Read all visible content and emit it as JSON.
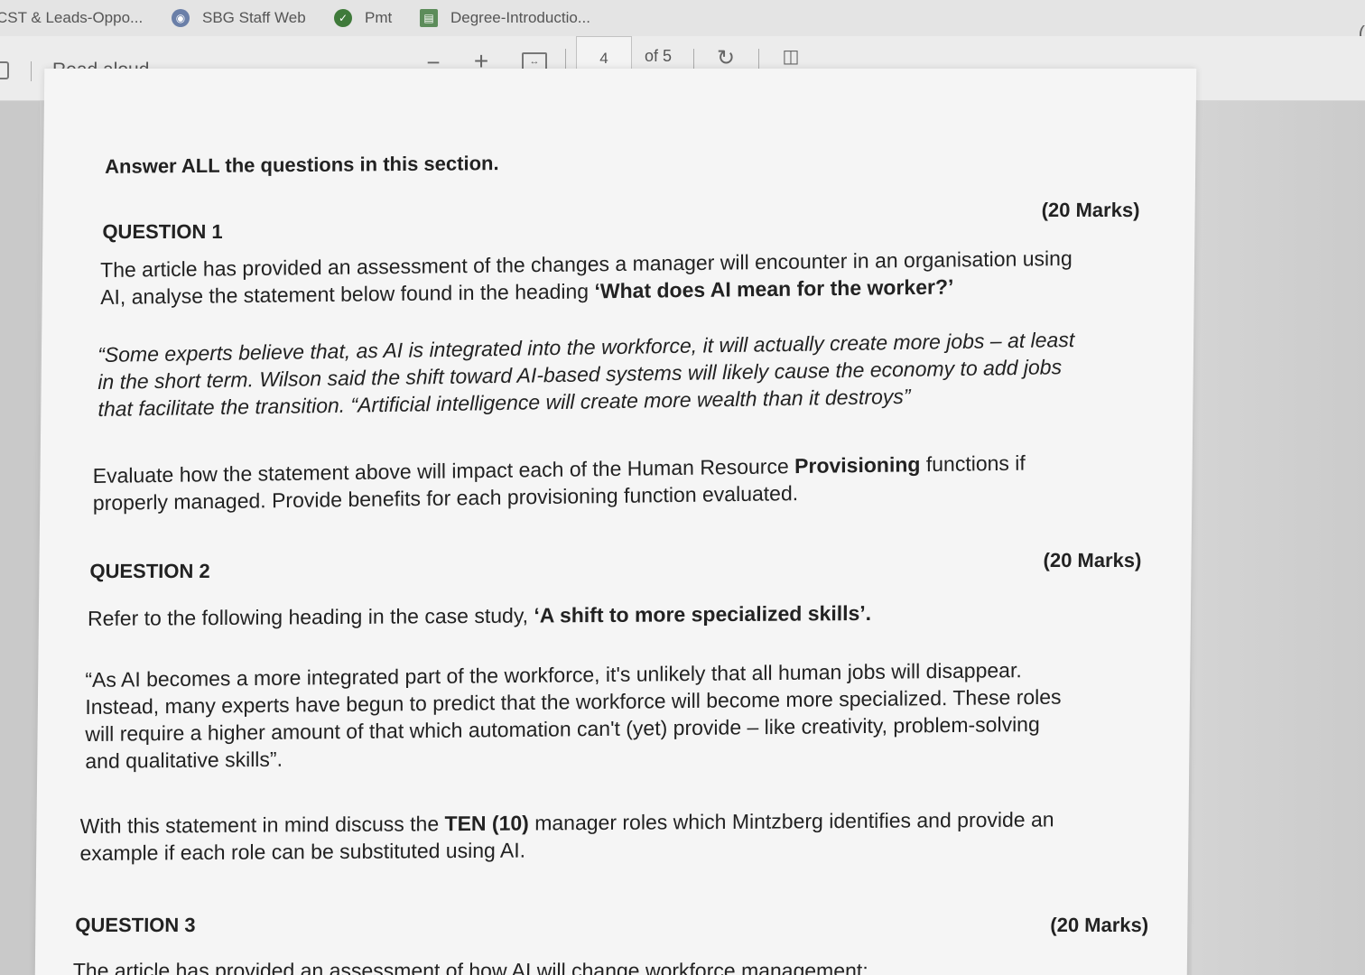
{
  "bookmarks": [
    {
      "label": "CST & Leads-Oppo...",
      "icon": "page-icon"
    },
    {
      "label": "SBG Staff Web",
      "icon": "globe-icon"
    },
    {
      "label": "Pmt",
      "icon": "check-icon"
    },
    {
      "label": "Degree-Introductio...",
      "icon": "book-icon"
    }
  ],
  "toolbar": {
    "read_aloud": "Read aloud",
    "zoom_out": "−",
    "zoom_in": "+",
    "page_current": "4",
    "page_total": "of 5"
  },
  "document": {
    "intro": "Answer ALL the questions in this section.",
    "q1": {
      "title": "QUESTION 1",
      "marks": "(20 Marks)",
      "p1_line1": "The article has provided an assessment of the changes a manager will encounter in an organisation using",
      "p1_line2_a": "AI, analyse the statement below found in the heading ",
      "p1_line2_b": "‘What does AI mean for the worker?’",
      "quote_line1": "“Some experts believe that, as AI is integrated into the workforce, it will actually create more jobs – at least",
      "quote_line2": "in the short term. Wilson said the shift toward AI-based systems will likely cause the economy to add jobs",
      "quote_line3": "that facilitate the transition. “Artificial intelligence will create more wealth than it destroys”",
      "task_line1_a": "Evaluate how the statement above will impact each of the Human Resource ",
      "task_line1_b": "Provisioning",
      "task_line1_c": " functions if",
      "task_line2": "properly managed. Provide benefits for each provisioning function evaluated."
    },
    "q2": {
      "title": "QUESTION 2",
      "marks": "(20 Marks)",
      "ref_a": "Refer to the following heading in the case study, ",
      "ref_b": "‘A shift to more specialized skills’.",
      "quote_line1": "“As AI becomes a more integrated part of the workforce, it's unlikely that all human jobs will disappear.",
      "quote_line2": "Instead, many experts have begun to predict that the workforce will become more specialized. These roles",
      "quote_line3": "will require a higher amount of that which automation can't (yet) provide – like creativity, problem-solving",
      "quote_line4": "and qualitative skills”.",
      "task_line1_a": "With this statement in mind discuss the ",
      "task_line1_b": "TEN (10)",
      "task_line1_c": " manager roles which Mintzberg identifies and provide an",
      "task_line2": "example if each role can be substituted using AI."
    },
    "q3": {
      "title": "QUESTION 3",
      "marks": "(20 Marks)",
      "line1": "The article has provided an assessment of how AI will change workforce management:"
    }
  }
}
